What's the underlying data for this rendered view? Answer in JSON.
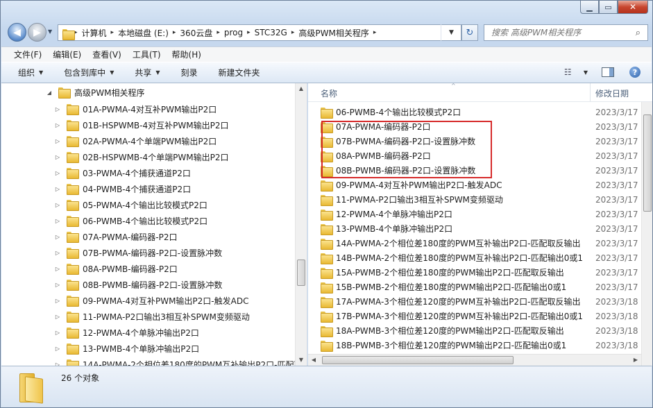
{
  "window": {
    "minimize_glyph": "▁",
    "maximize_glyph": "▭",
    "close_glyph": "✕"
  },
  "address": {
    "crumbs": [
      "计算机",
      "本地磁盘 (E:)",
      "360云盘",
      "prog",
      "STC32G",
      "高级PWM相关程序"
    ]
  },
  "search": {
    "placeholder": "搜索 高级PWM相关程序"
  },
  "menu": [
    "文件(F)",
    "编辑(E)",
    "查看(V)",
    "工具(T)",
    "帮助(H)"
  ],
  "commands": {
    "organize": "组织",
    "include_in_library": "包含到库中",
    "share": "共享",
    "burn": "刻录",
    "new_folder": "新建文件夹"
  },
  "nav": {
    "root": "高级PWM相关程序",
    "items": [
      "01A-PWMA-4对互补PWM输出P2口",
      "01B-HSPWMB-4对互补PWM输出P2口",
      "02A-PWMA-4个单端PWM输出P2口",
      "02B-HSPWMB-4个单端PWM输出P2口",
      "03-PWMA-4个捕获通道P2口",
      "04-PWMB-4个捕获通道P2口",
      "05-PWMA-4个输出比较模式P2口",
      "06-PWMB-4个输出比较模式P2口",
      "07A-PWMA-编码器-P2口",
      "07B-PWMA-编码器-P2口-设置脉冲数",
      "08A-PWMB-编码器-P2口",
      "08B-PWMB-编码器-P2口-设置脉冲数",
      "09-PWMA-4对互补PWM输出P2口-触发ADC",
      "11-PWMA-P2口输出3相互补SPWM变频驱动",
      "12-PWMA-4个单脉冲输出P2口",
      "13-PWMB-4个单脉冲输出P2口",
      "14A-PWMA-2个相位差180度的PWM互补输出P2口-匹配取"
    ]
  },
  "files": {
    "col_name": "名称",
    "col_date": "修改日期",
    "rows": [
      {
        "name": "06-PWMB-4个输出比较模式P2口",
        "date": "2023/3/17"
      },
      {
        "name": "07A-PWMA-编码器-P2口",
        "date": "2023/3/17"
      },
      {
        "name": "07B-PWMA-编码器-P2口-设置脉冲数",
        "date": "2023/3/17"
      },
      {
        "name": "08A-PWMB-编码器-P2口",
        "date": "2023/3/17"
      },
      {
        "name": "08B-PWMB-编码器-P2口-设置脉冲数",
        "date": "2023/3/17"
      },
      {
        "name": "09-PWMA-4对互补PWM输出P2口-触发ADC",
        "date": "2023/3/17"
      },
      {
        "name": "11-PWMA-P2口输出3相互补SPWM变频驱动",
        "date": "2023/3/17"
      },
      {
        "name": "12-PWMA-4个单脉冲输出P2口",
        "date": "2023/3/17"
      },
      {
        "name": "13-PWMB-4个单脉冲输出P2口",
        "date": "2023/3/17"
      },
      {
        "name": "14A-PWMA-2个相位差180度的PWM互补输出P2口-匹配取反输出",
        "date": "2023/3/17"
      },
      {
        "name": "14B-PWMA-2个相位差180度的PWM互补输出P2口-匹配输出0或1",
        "date": "2023/3/17"
      },
      {
        "name": "15A-PWMB-2个相位差180度的PWM输出P2口-匹配取反输出",
        "date": "2023/3/17"
      },
      {
        "name": "15B-PWMB-2个相位差180度的PWM输出P2口-匹配输出0或1",
        "date": "2023/3/17"
      },
      {
        "name": "17A-PWMA-3个相位差120度的PWM互补输出P2口-匹配取反输出",
        "date": "2023/3/18"
      },
      {
        "name": "17B-PWMA-3个相位差120度的PWM互补输出P2口-匹配输出0或1",
        "date": "2023/3/18"
      },
      {
        "name": "18A-PWMB-3个相位差120度的PWM输出P2口-匹配取反输出",
        "date": "2023/3/18"
      },
      {
        "name": "18B-PWMB-3个相位差120度的PWM输出P2口-匹配输出0或1",
        "date": "2023/3/18"
      }
    ]
  },
  "status": {
    "count": "26 个对象"
  },
  "colors": {
    "highlight": "#d62a2a"
  }
}
